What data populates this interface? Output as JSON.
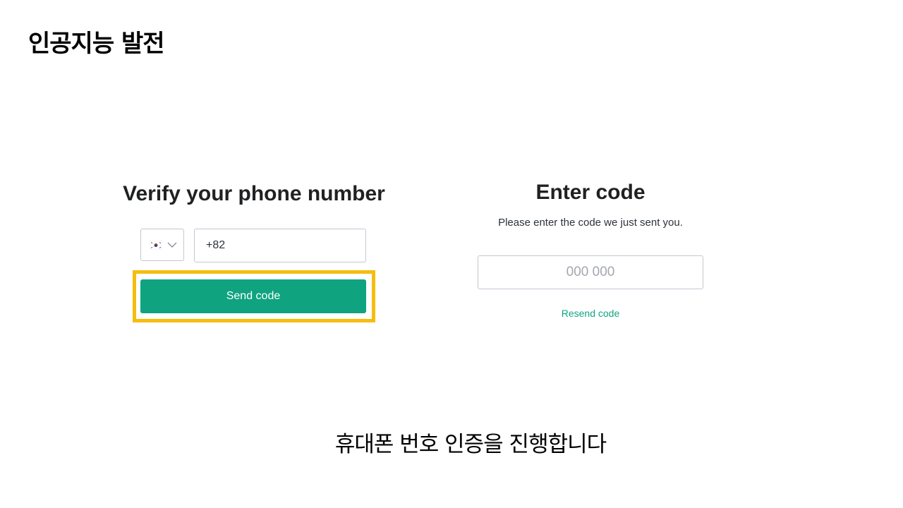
{
  "slide": {
    "title": "인공지능 발전",
    "caption": "휴대폰 번호 인증을 진행합니다"
  },
  "verify": {
    "heading": "Verify your phone number",
    "country": {
      "icon": "south-korea-flag-icon",
      "dropdown_icon": "chevron-down-icon"
    },
    "phone_value": "+82",
    "send_label": "Send code"
  },
  "code": {
    "heading": "Enter code",
    "subtext": "Please enter the code we just sent you.",
    "placeholder": "000 000",
    "resend_label": "Resend code"
  },
  "colors": {
    "accent": "#10a37f",
    "highlight": "#f6bd0e",
    "border": "#c2c8d0"
  }
}
